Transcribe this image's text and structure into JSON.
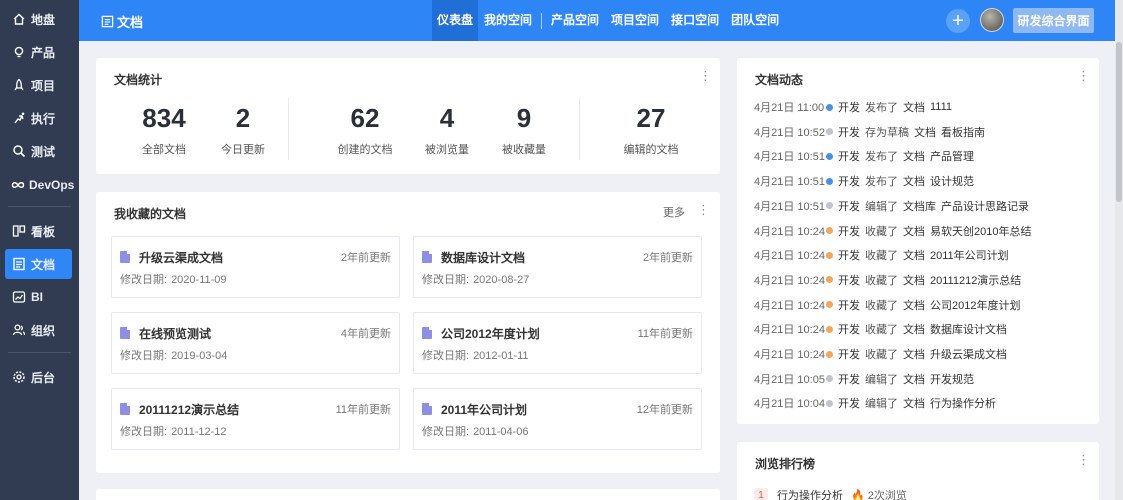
{
  "sidebar": {
    "items": [
      {
        "label": "地盘",
        "icon": "home-icon"
      },
      {
        "label": "产品",
        "icon": "lightbulb-icon"
      },
      {
        "label": "项目",
        "icon": "rocket-icon"
      },
      {
        "label": "执行",
        "icon": "run-icon"
      },
      {
        "label": "测试",
        "icon": "search-icon"
      },
      {
        "label": "DevOps",
        "icon": "infinity-icon"
      },
      {
        "label": "看板",
        "icon": "board-icon"
      },
      {
        "label": "文档",
        "icon": "document-icon",
        "active": true
      },
      {
        "label": "BI",
        "icon": "chart-icon"
      },
      {
        "label": "组织",
        "icon": "users-icon"
      },
      {
        "label": "后台",
        "icon": "gear-icon"
      }
    ]
  },
  "header": {
    "title": "文档",
    "nav": [
      "仪表盘",
      "我的空间",
      "产品空间",
      "项目空间",
      "接口空间",
      "团队空间"
    ],
    "active_nav": "仪表盘",
    "add_symbol": "+",
    "button_label": "研发综合界面"
  },
  "stats": {
    "title": "文档统计",
    "items": [
      {
        "value": "834",
        "label": "全部文档"
      },
      {
        "value": "2",
        "label": "今日更新"
      },
      {
        "value": "62",
        "label": "创建的文档"
      },
      {
        "value": "4",
        "label": "被浏览量"
      },
      {
        "value": "9",
        "label": "被收藏量"
      },
      {
        "value": "27",
        "label": "编辑的文档"
      }
    ]
  },
  "favorites": {
    "title": "我收藏的文档",
    "more_label": "更多",
    "date_prefix": "修改日期:",
    "items": [
      {
        "name": "升级云渠成文档",
        "ago": "2年前更新",
        "date": "2020-11-09"
      },
      {
        "name": "数据库设计文档",
        "ago": "2年前更新",
        "date": "2020-08-27"
      },
      {
        "name": "在线预览测试",
        "ago": "4年前更新",
        "date": "2019-03-04"
      },
      {
        "name": "公司2012年度计划",
        "ago": "11年前更新",
        "date": "2012-01-11"
      },
      {
        "name": "20111212演示总结",
        "ago": "11年前更新",
        "date": "2011-12-12"
      },
      {
        "name": "2011年公司计划",
        "ago": "12年前更新",
        "date": "2011-04-06"
      }
    ]
  },
  "activity": {
    "title": "文档动态",
    "colors": {
      "blue": "#4a90e2",
      "grey": "#c0c4cc",
      "orange": "#f5a65b"
    },
    "items": [
      {
        "time": "4月21日 11:00",
        "dot": "blue",
        "user": "开发",
        "action": "发布了",
        "type": "文档",
        "name": "1111"
      },
      {
        "time": "4月21日 10:52",
        "dot": "grey",
        "user": "开发",
        "action": "存为草稿",
        "type": "文档",
        "name": "看板指南"
      },
      {
        "time": "4月21日 10:51",
        "dot": "blue",
        "user": "开发",
        "action": "发布了",
        "type": "文档",
        "name": "产品管理"
      },
      {
        "time": "4月21日 10:51",
        "dot": "blue",
        "user": "开发",
        "action": "发布了",
        "type": "文档",
        "name": "设计规范"
      },
      {
        "time": "4月21日 10:51",
        "dot": "grey",
        "user": "开发",
        "action": "编辑了",
        "type": "文档库",
        "name": "产品设计思路记录"
      },
      {
        "time": "4月21日 10:24",
        "dot": "orange",
        "user": "开发",
        "action": "收藏了",
        "type": "文档",
        "name": "易软天创2010年总结"
      },
      {
        "time": "4月21日 10:24",
        "dot": "orange",
        "user": "开发",
        "action": "收藏了",
        "type": "文档",
        "name": "2011年公司计划"
      },
      {
        "time": "4月21日 10:24",
        "dot": "orange",
        "user": "开发",
        "action": "收藏了",
        "type": "文档",
        "name": "20111212演示总结"
      },
      {
        "time": "4月21日 10:24",
        "dot": "orange",
        "user": "开发",
        "action": "收藏了",
        "type": "文档",
        "name": "公司2012年度计划"
      },
      {
        "time": "4月21日 10:24",
        "dot": "orange",
        "user": "开发",
        "action": "收藏了",
        "type": "文档",
        "name": "数据库设计文档"
      },
      {
        "time": "4月21日 10:24",
        "dot": "orange",
        "user": "开发",
        "action": "收藏了",
        "type": "文档",
        "name": "升级云渠成文档"
      },
      {
        "time": "4月21日 10:05",
        "dot": "grey",
        "user": "开发",
        "action": "编辑了",
        "type": "文档",
        "name": "开发规范"
      },
      {
        "time": "4月21日 10:04",
        "dot": "grey",
        "user": "开发",
        "action": "编辑了",
        "type": "文档",
        "name": "行为操作分析"
      }
    ]
  },
  "ranking": {
    "title": "浏览排行榜",
    "items": [
      {
        "rank": "1",
        "name": "行为操作分析",
        "views": "2次浏览"
      }
    ]
  }
}
